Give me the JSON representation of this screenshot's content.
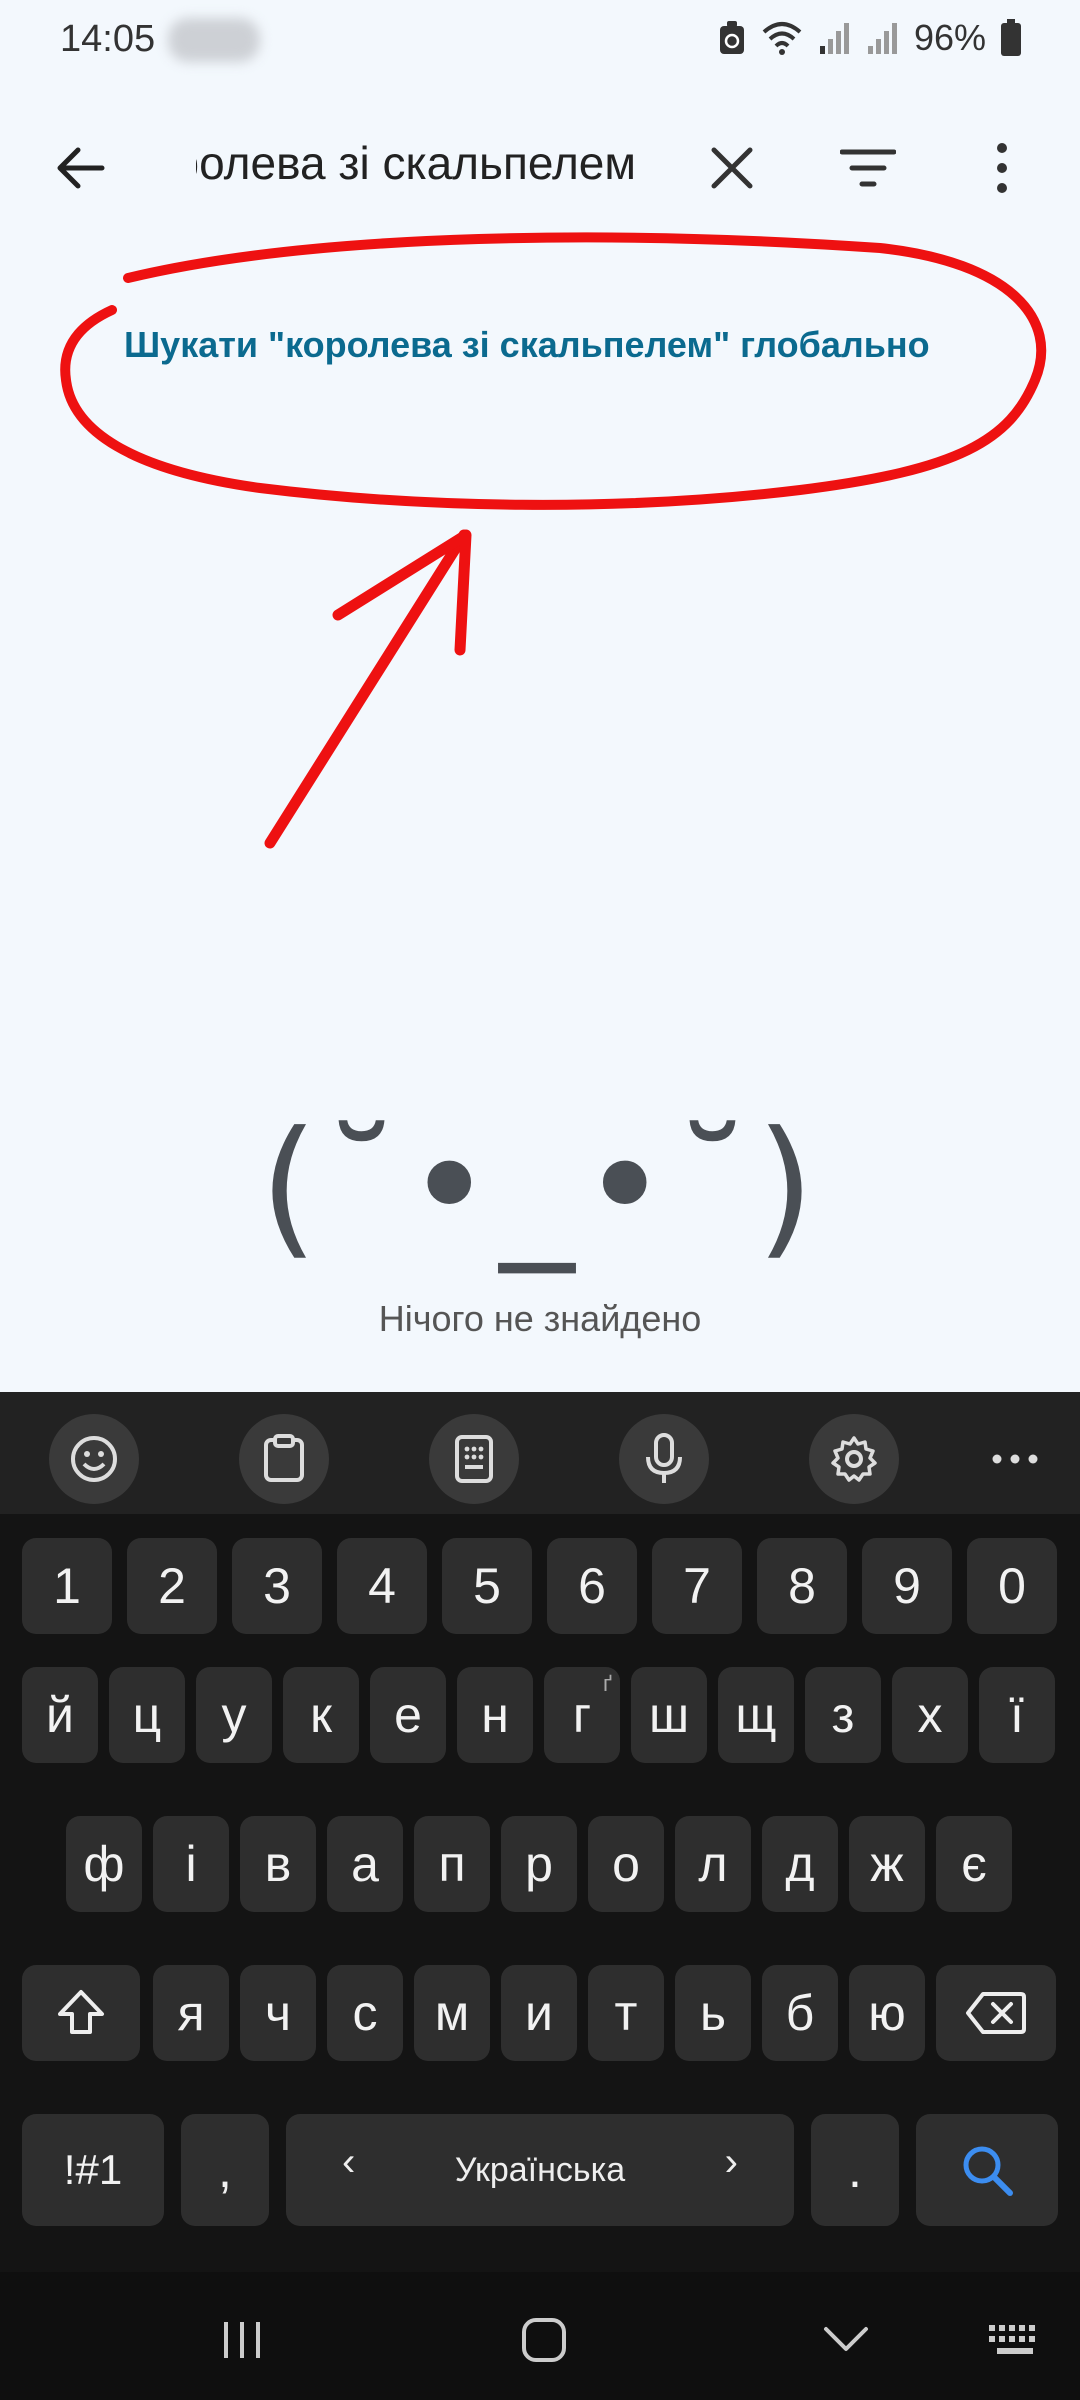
{
  "status_bar": {
    "time": "14:05",
    "battery": "96%",
    "icons": [
      "recycle-icon",
      "wifi-icon",
      "signal-icon",
      "signal-icon",
      "battery-icon"
    ]
  },
  "search": {
    "query": "королева зі скальпелем",
    "icons": [
      "arrow-back-icon",
      "close-icon",
      "filter-icon",
      "more-vert-icon"
    ]
  },
  "results": {
    "global_search_label": "Шукати \"королева зі скальпелем\" глобально",
    "empty_face": "(˘•_•˘)",
    "empty_text": "Нічого не знайдено"
  },
  "annotation": {
    "color": "#ee1111"
  },
  "keyboard": {
    "toolbar_icons": [
      "emoji-icon",
      "clipboard-icon",
      "keypad-icon",
      "microphone-icon",
      "settings-icon",
      "more-horiz-icon"
    ],
    "numbers": [
      "1",
      "2",
      "3",
      "4",
      "5",
      "6",
      "7",
      "8",
      "9",
      "0"
    ],
    "row1": [
      "й",
      "ц",
      "у",
      "к",
      "е",
      "н",
      "г",
      "ш",
      "щ",
      "з",
      "х",
      "ї"
    ],
    "row1_hint": "ґ",
    "row2": [
      "ф",
      "і",
      "в",
      "а",
      "п",
      "р",
      "о",
      "л",
      "д",
      "ж",
      "є"
    ],
    "row3": [
      "я",
      "ч",
      "с",
      "м",
      "и",
      "т",
      "ь",
      "б",
      "ю"
    ],
    "symbols_key": "!#1",
    "comma_key": ",",
    "space_label": "Українська",
    "period_key": ".",
    "accent_color": "#3c8df0"
  },
  "nav": {
    "icons": [
      "recent-apps-icon",
      "home-icon",
      "hide-keyboard-icon",
      "keyboard-icon"
    ]
  }
}
